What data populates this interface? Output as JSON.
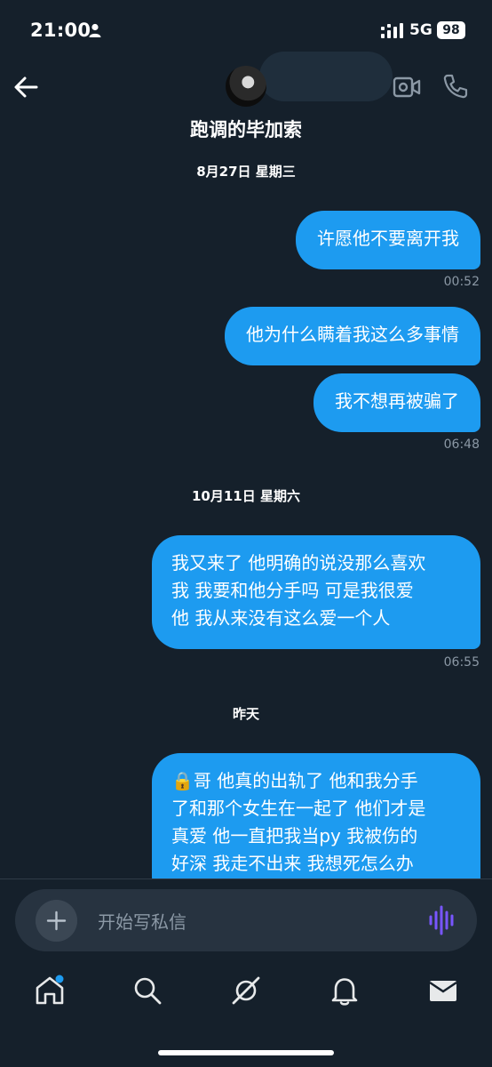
{
  "status_bar": {
    "time": "21:00",
    "network": "5G",
    "battery": "98"
  },
  "header": {
    "contact_name": "跑调的毕加索"
  },
  "messages": [
    {
      "date": "8月27日 星期三"
    },
    {
      "text": "许愿他不要离开我",
      "time": "00:52"
    },
    {
      "text": "他为什么瞒着我这么多事情"
    },
    {
      "text": "我不想再被骗了",
      "time": "06:48"
    },
    {
      "date": "10月11日 星期六"
    },
    {
      "lines": [
        "我又来了 他明确的说没那么喜欢",
        "我 我要和他分手吗 可是我很爱",
        "他 我从来没有这么爱一个人"
      ],
      "time": "06:55"
    },
    {
      "date": "昨天"
    },
    {
      "lines": [
        "🔒哥 他真的出轨了 他和我分手",
        "了和那个女生在一起了 他们才是",
        "真爱 他一直把我当py 我被伤的",
        "好深 我走不出来 我想死怎么办"
      ]
    }
  ],
  "composer": {
    "placeholder": "开始写私信"
  },
  "colors": {
    "background": "#15202b",
    "bubble": "#1d9bf0",
    "muted": "#8b98a5",
    "accent": "#7856ff"
  },
  "icons": [
    "back-arrow-icon",
    "video-call-icon",
    "phone-call-icon",
    "plus-icon",
    "voice-wave-icon",
    "home-icon",
    "search-icon",
    "grok-icon",
    "bell-icon",
    "mail-icon"
  ]
}
